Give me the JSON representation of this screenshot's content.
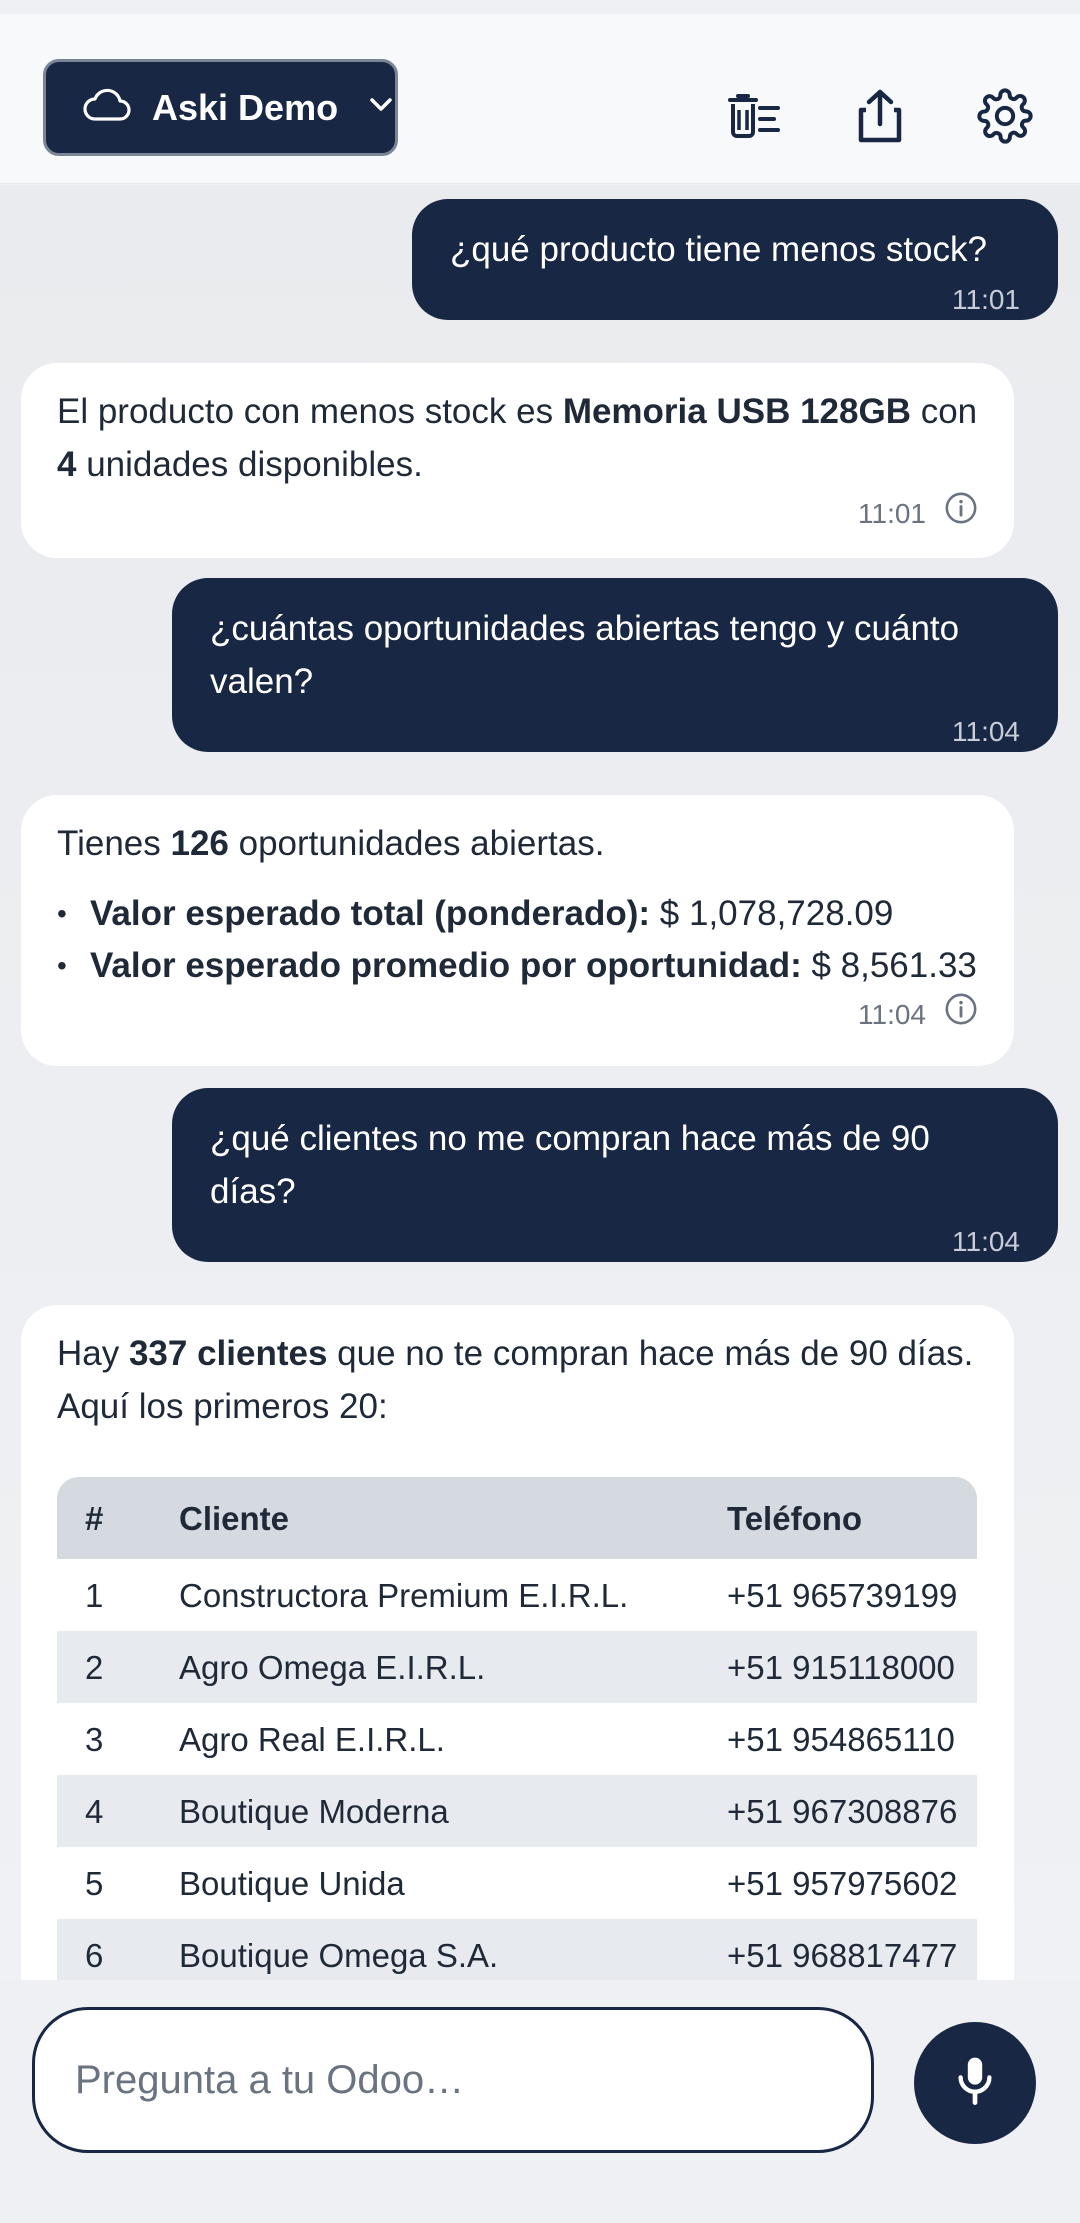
{
  "header": {
    "workspace_name": "Aski Demo",
    "icons": [
      "cloud-icon",
      "chevron-down-icon",
      "clear-chat-icon",
      "share-icon",
      "gear-icon"
    ]
  },
  "messages": [
    {
      "role": "user",
      "text": "¿qué producto tiene menos stock?",
      "time": "11:01"
    },
    {
      "role": "assistant",
      "pre": "El producto con menos stock es ",
      "bold1": "Memoria USB 128GB",
      "mid": " con ",
      "bold2": "4",
      "post": " unidades disponibles.",
      "time": "11:01"
    },
    {
      "role": "user",
      "text": "¿cuántas oportunidades abiertas tengo y cuánto valen?",
      "time": "11:04"
    },
    {
      "role": "assistant",
      "pre": "Tienes ",
      "bold1": "126",
      "post": " oportunidades abiertas.",
      "bullets": [
        {
          "label": "Valor esperado total (ponderado):",
          "value": " $ 1,078,728.09"
        },
        {
          "label": "Valor esperado promedio por oportunidad:",
          "value": " $ 8,561.33"
        }
      ],
      "time": "11:04"
    },
    {
      "role": "user",
      "text": "¿qué clientes no me compran hace más de 90 días?",
      "time": "11:04"
    },
    {
      "role": "assistant",
      "pre": "Hay ",
      "bold1": "337 clientes",
      "post": " que no te compran hace más de 90 días. Aquí los primeros 20:",
      "table": {
        "headers": [
          "#",
          "Cliente",
          "Teléfono"
        ],
        "rows": [
          [
            "1",
            "Constructora Premium E.I.R.L.",
            "+51 965739199"
          ],
          [
            "2",
            "Agro Omega E.I.R.L.",
            "+51 915118000"
          ],
          [
            "3",
            "Agro Real E.I.R.L.",
            "+51 954865110"
          ],
          [
            "4",
            "Boutique Moderna",
            "+51 967308876"
          ],
          [
            "5",
            "Boutique Unida",
            "+51 957975602"
          ],
          [
            "6",
            "Boutique Omega S.A.",
            "+51 968817477"
          ]
        ]
      }
    }
  ],
  "composer": {
    "placeholder": "Pregunta a tu Odoo…"
  },
  "colors": {
    "primary": "#182743",
    "background": "#eef0f3",
    "bubble_bot": "#ffffff",
    "table_header": "#d5d9e0"
  }
}
